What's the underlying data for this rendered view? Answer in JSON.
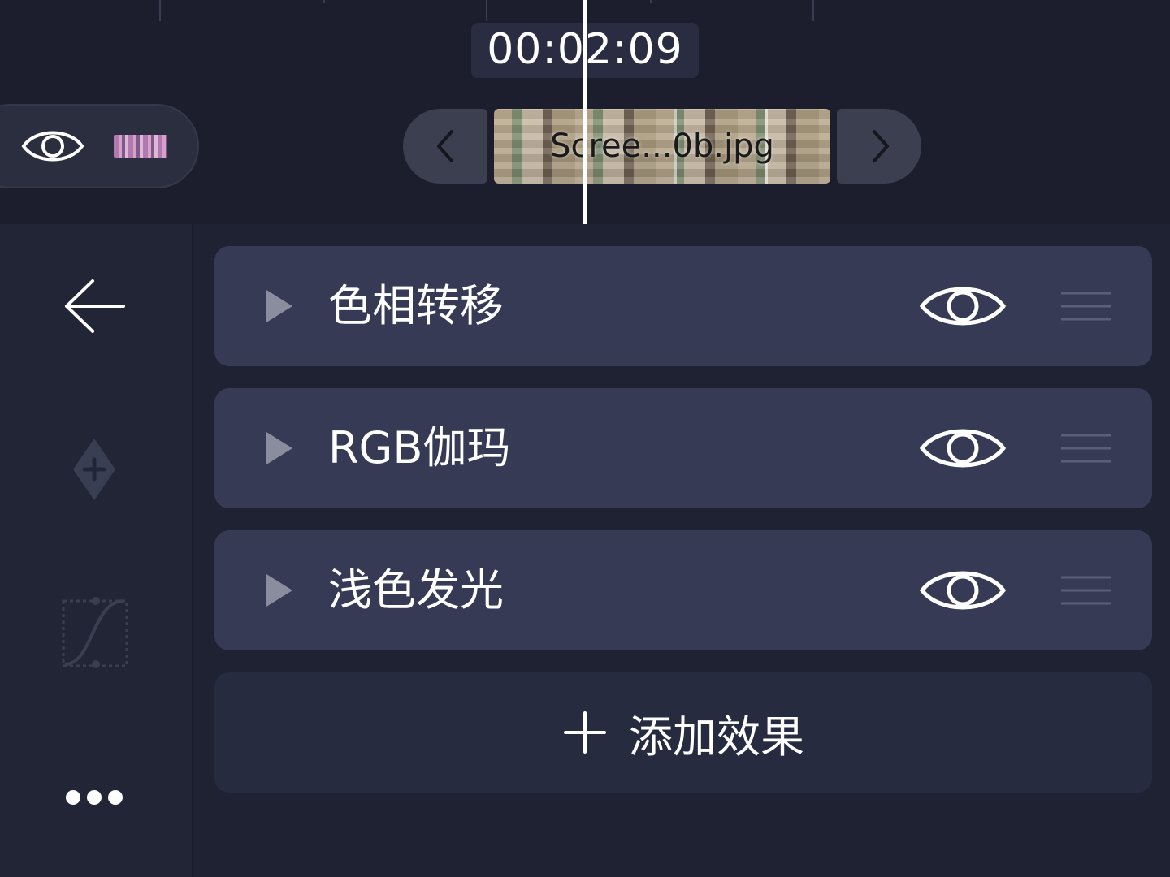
{
  "timeline": {
    "timecode": "00:02:09",
    "clip_name": "Scree...0b.jpg"
  },
  "effects": [
    {
      "name": "色相转移",
      "visible": true
    },
    {
      "name": "RGB伽玛",
      "visible": true
    },
    {
      "name": "浅色发光",
      "visible": true
    }
  ],
  "add_effect_label": "添加效果",
  "colors": {
    "background": "#1f2233",
    "row": "#363a55",
    "add_row": "#272b40",
    "text": "#ffffff",
    "playhead": "#ffffff"
  },
  "icons": {
    "back": "arrow-left-icon",
    "keyframe": "add-keyframe-icon",
    "curve": "easing-curve-icon",
    "more": "more-dots-icon",
    "expand": "play-triangle-icon",
    "visibility": "eye-icon",
    "reorder": "drag-handle-icon",
    "add": "plus-icon"
  }
}
